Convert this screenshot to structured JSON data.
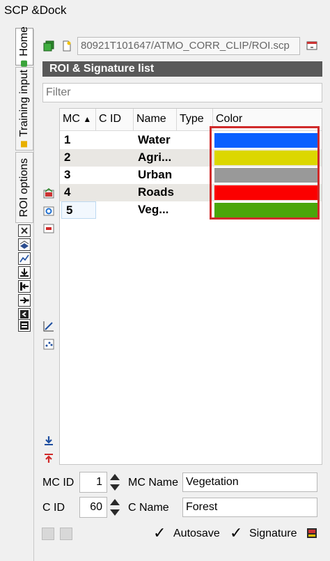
{
  "window": {
    "title": "SCP &Dock"
  },
  "vertical_tabs": [
    {
      "label": "Home",
      "dot_color": "#3aa33a"
    },
    {
      "label": "Training input",
      "dot_color": "#e8b000"
    },
    {
      "label": "ROI options"
    }
  ],
  "side_icons": [
    "tool-icon-1",
    "tool-icon-2",
    "tool-icon-3",
    "tool-icon-4",
    "tool-icon-5",
    "tool-icon-6",
    "tool-icon-7",
    "tool-icon-8"
  ],
  "toolbar": {
    "path": "80921T101647/ATMO_CORR_CLIP/ROI.scp"
  },
  "section": {
    "title": "ROI & Signature list"
  },
  "filter": {
    "placeholder": "Filter"
  },
  "table": {
    "headers": {
      "mc": "MC",
      "cid": "C ID",
      "name": "Name",
      "type": "Type",
      "color": "Color"
    },
    "sort_indicator": "▲",
    "rows": [
      {
        "mc": "1",
        "cid": "",
        "name": "Water",
        "type": "",
        "color": "#0a5fff"
      },
      {
        "mc": "2",
        "cid": "",
        "name": "Agri...",
        "type": "",
        "color": "#dcd700"
      },
      {
        "mc": "3",
        "cid": "",
        "name": "Urban",
        "type": "",
        "color": "#999999"
      },
      {
        "mc": "4",
        "cid": "",
        "name": "Roads",
        "type": "",
        "color": "#fb0000"
      },
      {
        "mc": "5",
        "cid": "",
        "name": "Veg...",
        "type": "",
        "color": "#4aa60a"
      }
    ]
  },
  "form": {
    "mc_id_label": "MC ID",
    "mc_id_value": "1",
    "mc_name_label": "MC Name",
    "mc_name_value": "Vegetation",
    "c_id_label": "C ID",
    "c_id_value": "60",
    "c_name_label": "C Name",
    "c_name_value": "Forest"
  },
  "options": {
    "check_mark": "✓",
    "autosave_label": "Autosave",
    "signature_label": "Signature"
  },
  "colors": {
    "header_bg": "#595959",
    "highlight": "#d02a2a",
    "alt_row": "#e9e7e3"
  }
}
